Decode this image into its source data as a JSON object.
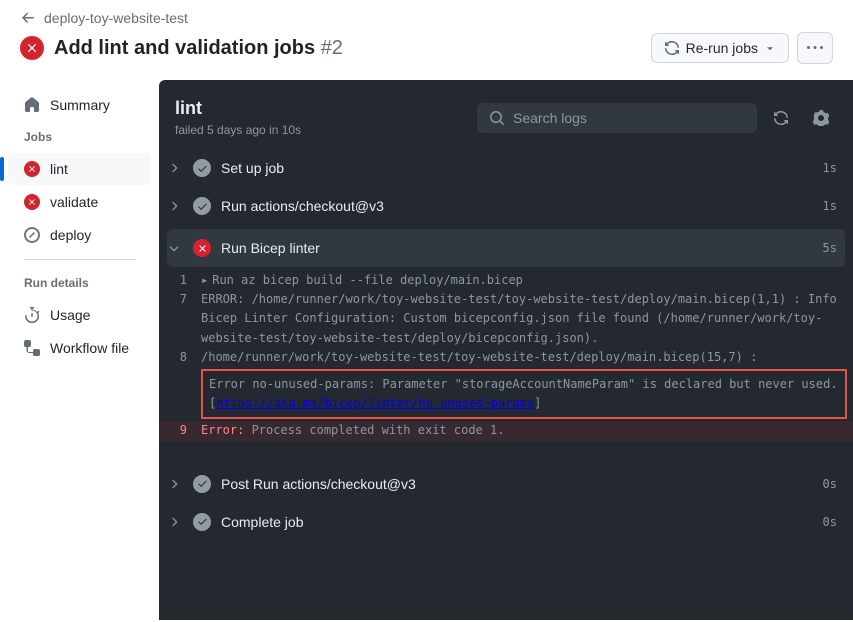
{
  "breadcrumb": {
    "link": "deploy-toy-website-test"
  },
  "title": "Add lint and validation jobs",
  "run_number": "#2",
  "buttons": {
    "rerun": "Re-run jobs"
  },
  "sidebar": {
    "summary": "Summary",
    "jobs_header": "Jobs",
    "items": [
      {
        "label": "lint",
        "status": "fail"
      },
      {
        "label": "validate",
        "status": "fail"
      },
      {
        "label": "deploy",
        "status": "skip"
      }
    ],
    "run_details_header": "Run details",
    "usage": "Usage",
    "workflow_file": "Workflow file"
  },
  "logs": {
    "title": "lint",
    "subtitle": "failed 5 days ago in 10s",
    "search_placeholder": "Search logs",
    "steps": [
      {
        "label": "Set up job",
        "time": "1s",
        "status": "ok",
        "expanded": false
      },
      {
        "label": "Run actions/checkout@v3",
        "time": "1s",
        "status": "ok",
        "expanded": false
      },
      {
        "label": "Run Bicep linter",
        "time": "5s",
        "status": "fail",
        "expanded": true
      },
      {
        "label": "Post Run actions/checkout@v3",
        "time": "0s",
        "status": "ok",
        "expanded": false
      },
      {
        "label": "Complete job",
        "time": "0s",
        "status": "ok",
        "expanded": false
      }
    ],
    "lines": {
      "l1_num": "1",
      "l1_txt": "Run az bicep build --file deploy/main.bicep",
      "l7_num": "7",
      "l7_txt": "ERROR: /home/runner/work/toy-website-test/toy-website-test/deploy/main.bicep(1,1) : Info Bicep Linter Configuration: Custom bicepconfig.json file found (/home/runner/work/toy-website-test/toy-website-test/deploy/bicepconfig.json).",
      "l8_num": "8",
      "l8_pre": "/home/runner/work/toy-website-test/toy-website-test/deploy/main.bicep(15,7) : ",
      "l8_box_pre": "Error no-unused-params: Parameter \"storageAccountNameParam\" is declared but never used. [",
      "l8_box_link": "https://aka.ms/bicep/linter/no-unused-params",
      "l8_box_post": "]",
      "l9_num": "9",
      "l9_prefix": "Error:",
      "l9_rest": " Process completed with exit code 1."
    }
  }
}
